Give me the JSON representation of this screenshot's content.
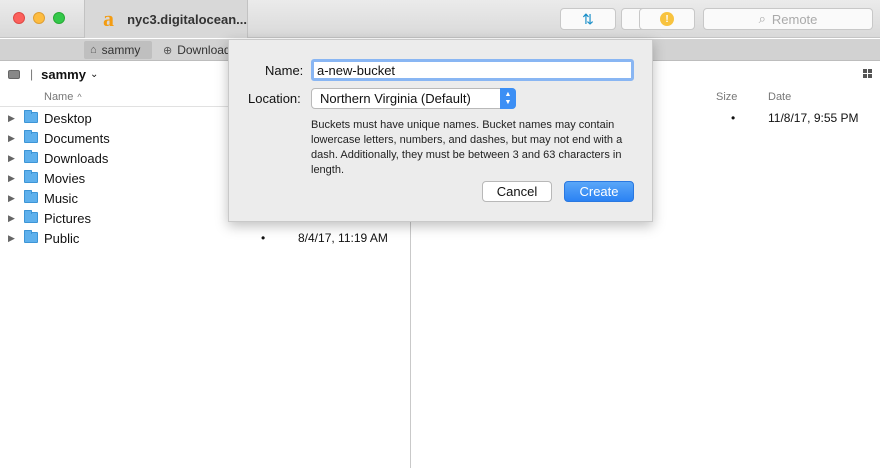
{
  "window": {
    "title": "nyc3.digitalocean...",
    "search_placeholder": "Remote",
    "info_glyph": "!"
  },
  "tabs": [
    {
      "label": "sammy"
    },
    {
      "label": "Downloads"
    }
  ],
  "left_pane": {
    "path": "sammy",
    "column_name": "Name",
    "items": [
      {
        "label": "Desktop",
        "size": "",
        "date": ""
      },
      {
        "label": "Documents",
        "size": "",
        "date": ""
      },
      {
        "label": "Downloads",
        "size": "",
        "date": ""
      },
      {
        "label": "Movies",
        "size": "",
        "date": ""
      },
      {
        "label": "Music",
        "size": "",
        "date": ""
      },
      {
        "label": "Pictures",
        "size": "",
        "date": ""
      },
      {
        "label": "Public",
        "size": "•",
        "date": "8/4/17, 11:19 AM"
      }
    ]
  },
  "right_pane": {
    "column_size": "Size",
    "column_date": "Date",
    "row": {
      "size": "•",
      "date": "11/8/17, 9:55 PM"
    }
  },
  "dialog": {
    "name_label": "Name:",
    "name_value": "a-new-bucket",
    "location_label": "Location:",
    "location_value": "Northern Virginia (Default)",
    "help_text": "Buckets must have unique names. Bucket names may contain lowercase letters, numbers, and dashes, but may not end with a dash. Additionally, they must be between 3 and 63 characters in length.",
    "cancel_label": "Cancel",
    "create_label": "Create"
  },
  "colors": {
    "accent": "#2b82f3",
    "folder": "#5eb0ec"
  }
}
